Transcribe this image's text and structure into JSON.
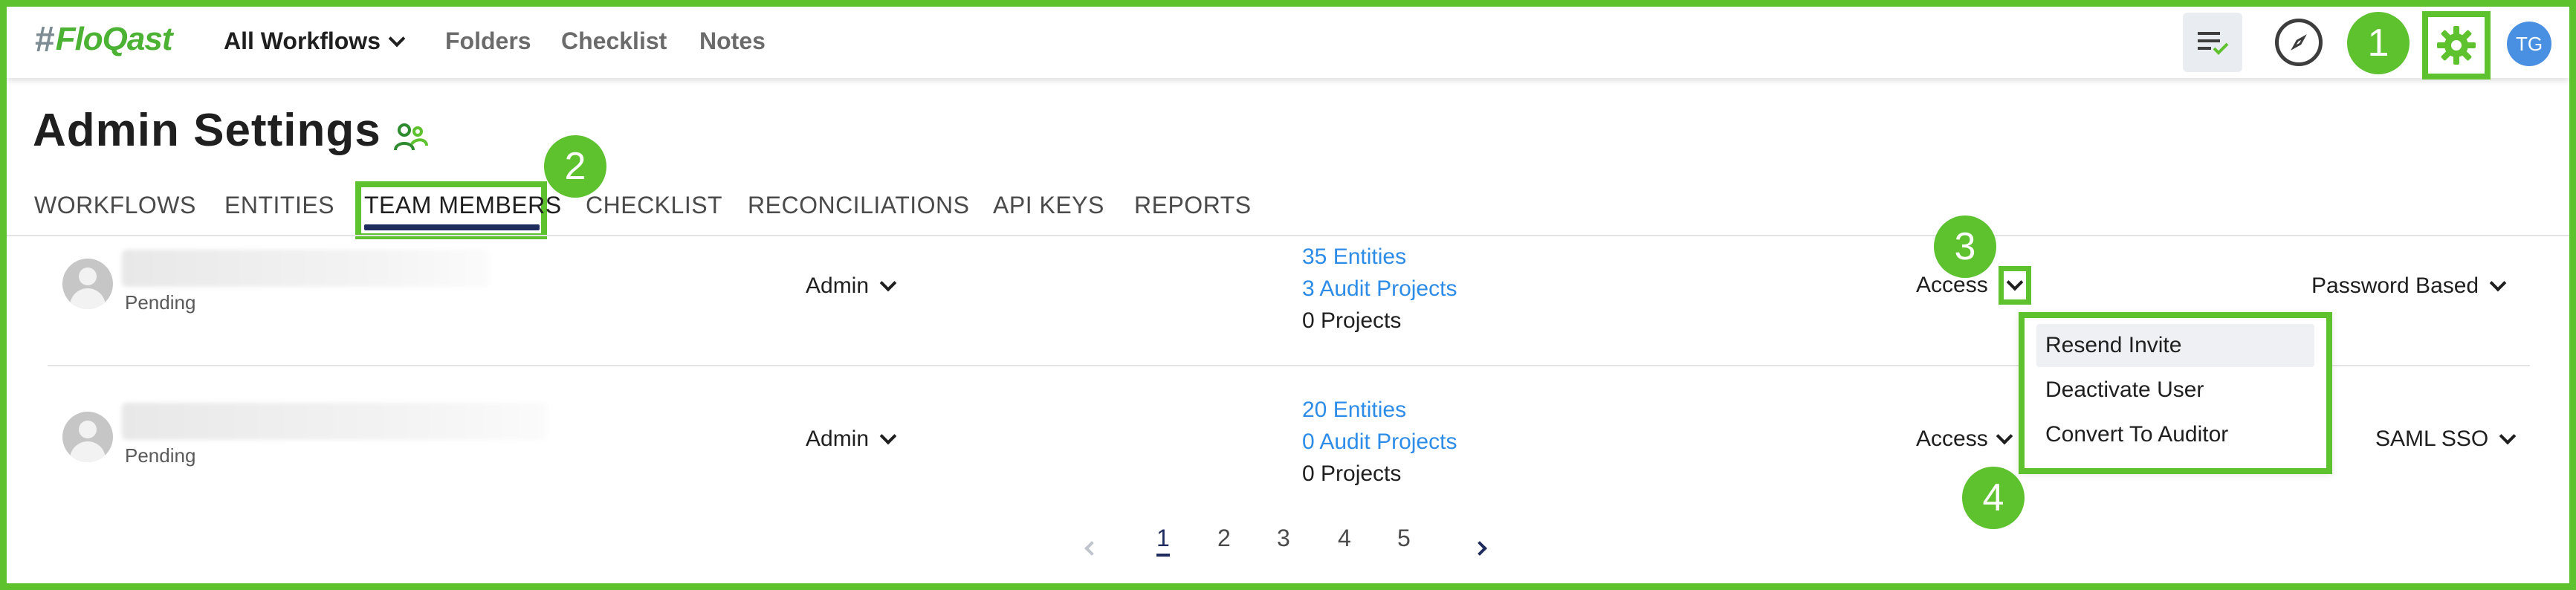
{
  "app": {
    "logo_text": "FloQast",
    "logo_hash": "#"
  },
  "topnav": {
    "workflows": "All Workflows",
    "folders": "Folders",
    "checklist": "Checklist",
    "notes": "Notes",
    "user_initials": "TG"
  },
  "page": {
    "title": "Admin Settings"
  },
  "tabs": [
    {
      "label": "WORKFLOWS"
    },
    {
      "label": "ENTITIES"
    },
    {
      "label": "TEAM MEMBERS"
    },
    {
      "label": "CHECKLIST"
    },
    {
      "label": "RECONCILIATIONS"
    },
    {
      "label": "API KEYS"
    },
    {
      "label": "REPORTS"
    }
  ],
  "members": [
    {
      "status": "Pending",
      "role": "Admin",
      "entities": "35 Entities",
      "audit_projects": "3 Audit Projects",
      "projects": "0 Projects",
      "access": "Access",
      "auth": "Password Based"
    },
    {
      "status": "Pending",
      "role": "Admin",
      "entities": "20 Entities",
      "audit_projects": "0 Audit Projects",
      "projects": "0 Projects",
      "access": "Access",
      "auth": "SAML SSO"
    }
  ],
  "access_menu": [
    {
      "label": "Resend Invite"
    },
    {
      "label": "Deactivate User"
    },
    {
      "label": "Convert To Auditor"
    }
  ],
  "pagination": {
    "pages": [
      "1",
      "2",
      "3",
      "4",
      "5"
    ],
    "current": "1"
  },
  "callouts": [
    "1",
    "2",
    "3",
    "4"
  ],
  "colors": {
    "highlight": "#5ec12e",
    "link": "#2d8ce8",
    "navy": "#1f2c5e",
    "brand": "#4cb233"
  },
  "icons": [
    "chevron-down-icon",
    "tasks-check-icon",
    "compass-icon",
    "gear-icon",
    "team-members-icon",
    "user-placeholder-icon",
    "chevron-left-icon",
    "chevron-right-icon"
  ]
}
